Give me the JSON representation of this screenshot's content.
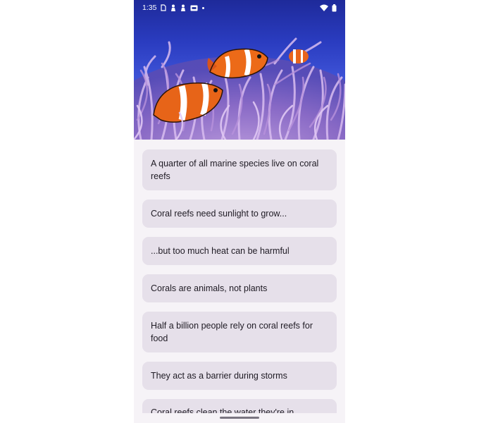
{
  "status_bar": {
    "time": "1:35",
    "left_icons": [
      "sim-icon",
      "notification-icon",
      "notification-icon",
      "cast-icon",
      "dot-icon"
    ],
    "right_icons": [
      "wifi-icon",
      "battery-icon"
    ]
  },
  "hero": {
    "image": "clownfish-in-anemone"
  },
  "facts": [
    "A quarter of all marine species live on coral reefs",
    "Coral reefs need sunlight to grow...",
    "...but too much heat can be harmful",
    "Corals are animals, not plants",
    "Half a billion people rely on coral reefs for food",
    "They act as a barrier during storms",
    "Coral reefs clean the water they're in"
  ],
  "colors": {
    "card_bg": "#e6e0ea",
    "screen_bg": "#f6f3f7",
    "text": "#1f1b24"
  }
}
